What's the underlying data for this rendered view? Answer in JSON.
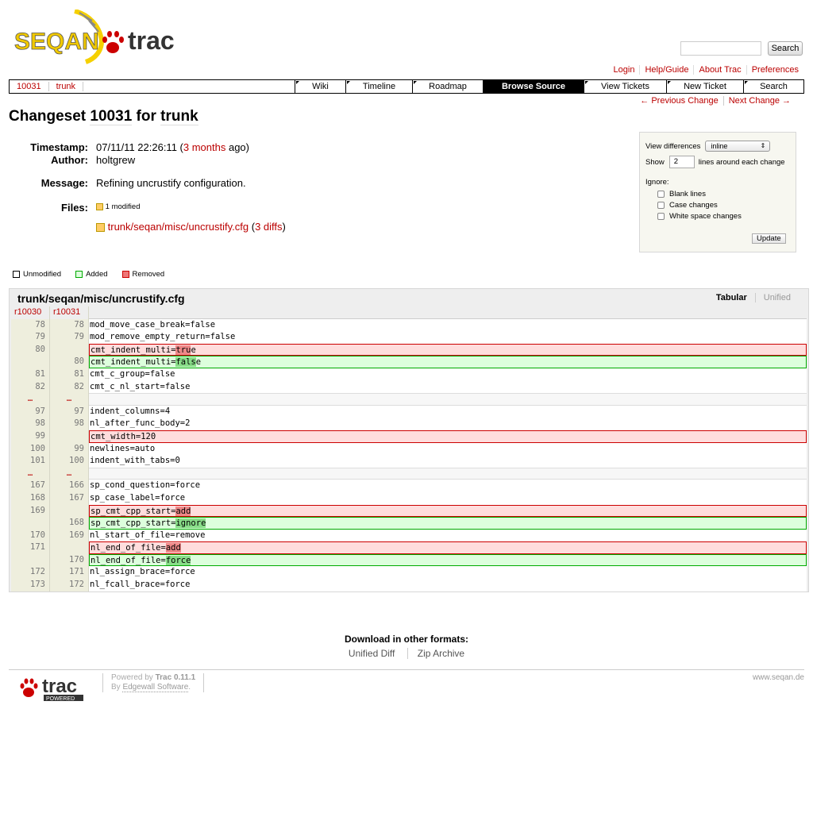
{
  "logo": {
    "seqan": "SEQAN",
    "trac": "trac"
  },
  "search": {
    "button": "Search"
  },
  "metanav": [
    "Login",
    "Help/Guide",
    "About Trac",
    "Preferences"
  ],
  "ctxnav": {
    "path": [
      "10031",
      "trunk"
    ],
    "mainnav": [
      "Wiki",
      "Timeline",
      "Roadmap",
      "Browse Source",
      "View Tickets",
      "New Ticket",
      "Search"
    ],
    "active": "Browse Source"
  },
  "changenav": {
    "prev": "← Previous Change",
    "next": "Next Change →"
  },
  "title": {
    "prefix": "Changeset",
    "rev": "10031",
    "mid": "for",
    "path": "trunk"
  },
  "props": {
    "timestamp_label": "Timestamp:",
    "timestamp": "07/11/11 22:26:11 (",
    "ago_link": "3 months",
    "ago_suffix": " ago)",
    "author_label": "Author:",
    "author": "holtgrew",
    "message_label": "Message:",
    "message": "Refining uncrustify configuration.",
    "files_label": "Files:",
    "files_summary": "1 modified",
    "file_path": "trunk/seqan/misc/uncrustify.cfg",
    "diffs_link": "3 diffs"
  },
  "prefs": {
    "view_label": "View differences",
    "view_value": "inline",
    "show_label": "Show",
    "show_value": "2",
    "show_suffix": "lines around each change",
    "ignore_label": "Ignore:",
    "blank": "Blank lines",
    "case": "Case changes",
    "whitespace": "White space changes",
    "update": "Update"
  },
  "legend": {
    "unmodified": "Unmodified",
    "added": "Added",
    "removed": "Removed",
    "colors": {
      "unmodified": "#ffffff",
      "added": "#ddffdd",
      "removed": "#ee7777"
    }
  },
  "diff": {
    "file": "trunk/seqan/misc/uncrustify.cfg",
    "tabular": "Tabular",
    "unified": "Unified",
    "old_rev": "r10030",
    "new_rev": "r10031",
    "rows": [
      {
        "t": "ctx",
        "o": "78",
        "n": "78",
        "pre": "mod_move_case_break=false",
        "h": "",
        "post": ""
      },
      {
        "t": "ctx",
        "o": "79",
        "n": "79",
        "pre": "mod_remove_empty_return=false",
        "h": "",
        "post": ""
      },
      {
        "t": "rem",
        "first": true,
        "o": "80",
        "n": "",
        "pre": "cmt_indent_multi=",
        "h": "tru",
        "post": "e"
      },
      {
        "t": "add",
        "first": true,
        "o": "",
        "n": "80",
        "pre": "cmt_indent_multi=",
        "h": "fals",
        "post": "e"
      },
      {
        "t": "ctx",
        "o": "81",
        "n": "81",
        "pre": "cmt_c_group=false",
        "h": "",
        "post": ""
      },
      {
        "t": "ctx",
        "o": "82",
        "n": "82",
        "pre": "cmt_c_nl_start=false",
        "h": "",
        "post": ""
      },
      {
        "t": "skip",
        "o": "…",
        "n": "…",
        "pre": "",
        "h": "",
        "post": ""
      },
      {
        "t": "ctx",
        "o": "97",
        "n": "97",
        "pre": "indent_columns=4",
        "h": "",
        "post": ""
      },
      {
        "t": "ctx",
        "o": "98",
        "n": "98",
        "pre": "nl_after_func_body=2",
        "h": "",
        "post": ""
      },
      {
        "t": "rem",
        "first": true,
        "o": "99",
        "n": "",
        "pre": "cmt_width=120",
        "h": "",
        "post": ""
      },
      {
        "t": "ctx",
        "o": "100",
        "n": "99",
        "pre": "newlines=auto",
        "h": "",
        "post": ""
      },
      {
        "t": "ctx",
        "o": "101",
        "n": "100",
        "pre": "indent_with_tabs=0",
        "h": "",
        "post": ""
      },
      {
        "t": "skip",
        "o": "…",
        "n": "…",
        "pre": "",
        "h": "",
        "post": ""
      },
      {
        "t": "ctx",
        "o": "167",
        "n": "166",
        "pre": "sp_cond_question=force",
        "h": "",
        "post": ""
      },
      {
        "t": "ctx",
        "o": "168",
        "n": "167",
        "pre": "sp_case_label=force",
        "h": "",
        "post": ""
      },
      {
        "t": "rem",
        "first": true,
        "o": "169",
        "n": "",
        "pre": "sp_cmt_cpp_start=",
        "h": "add",
        "post": ""
      },
      {
        "t": "add",
        "first": true,
        "o": "",
        "n": "168",
        "pre": "sp_cmt_cpp_start=",
        "h": "ignore",
        "post": ""
      },
      {
        "t": "ctx",
        "o": "170",
        "n": "169",
        "pre": "nl_start_of_file=remove",
        "h": "",
        "post": ""
      },
      {
        "t": "rem",
        "first": true,
        "o": "171",
        "n": "",
        "pre": "nl_end_of_file=",
        "h": "add",
        "post": ""
      },
      {
        "t": "add",
        "first": true,
        "o": "",
        "n": "170",
        "pre": "nl_end_of_file=",
        "h": "force",
        "post": ""
      },
      {
        "t": "ctx",
        "o": "172",
        "n": "171",
        "pre": "nl_assign_brace=force",
        "h": "",
        "post": ""
      },
      {
        "t": "ctx",
        "o": "173",
        "n": "172",
        "pre": "nl_fcall_brace=force",
        "h": "",
        "post": ""
      }
    ]
  },
  "download": {
    "title": "Download in other formats:",
    "unified": "Unified Diff",
    "zip": "Zip Archive"
  },
  "footer": {
    "powered": "Powered by ",
    "trac": "Trac 0.11.1",
    "by": "By ",
    "edgewall": "Edgewall Software",
    "dot": ".",
    "site": "www.seqan.de",
    "trac_logo": "trac",
    "powered_badge": "POWERED"
  }
}
